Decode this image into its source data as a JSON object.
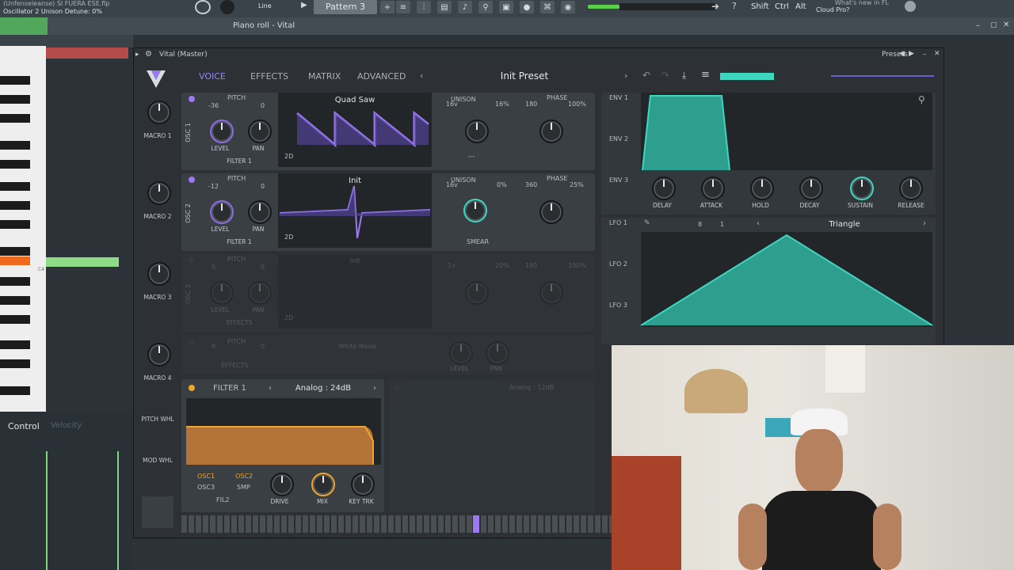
{
  "fl": {
    "title_line": "(Unfenseleanse) SI FUERA ESE.flp",
    "hint_line": "Oscillator 2 Unison Detune: 0%",
    "line_label": "Line",
    "pattern_label": "Pattern 3",
    "shift_label": "Shift",
    "ctrl_label": "Ctrl",
    "alt_label": "Alt",
    "news_label": "What's new in FL",
    "cloud_label": "Cloud Pro?",
    "piano_roll_title": "Piano roll - Vital",
    "control_label": "Control",
    "velocity_label": "Velocity",
    "note_label": "C4"
  },
  "vital": {
    "window_title": "Vital (Master)",
    "presets_label": "Presets",
    "tabs": [
      "VOICE",
      "EFFECTS",
      "MATRIX",
      "ADVANCED"
    ],
    "preset_name": "Init Preset",
    "macros": [
      "MACRO 1",
      "MACRO 2",
      "MACRO 3",
      "MACRO 4"
    ],
    "pitch_whl": "PITCH WHL",
    "mod_whl": "MOD WHL",
    "osc1": {
      "side": "OSC 1",
      "pitch_label": "PITCH",
      "pitch_val": "-36",
      "fine_val": "0",
      "level": "LEVEL",
      "pan": "PAN",
      "route": "FILTER 1",
      "wave": "Quad Saw",
      "mode": "2D",
      "unison": "UNISON",
      "voices": "16v",
      "detune": "16%",
      "phase": "PHASE",
      "phase_val": "180",
      "phase_rand": "100%",
      "blend": "---"
    },
    "osc2": {
      "side": "OSC 2",
      "pitch_label": "PITCH",
      "pitch_val": "-12",
      "fine_val": "0",
      "level": "LEVEL",
      "pan": "PAN",
      "route": "FILTER 1",
      "wave": "Init",
      "mode": "2D",
      "unison": "UNISON",
      "voices": "16v",
      "detune": "0%",
      "phase": "PHASE",
      "phase_val": "360",
      "phase_rand": "25%",
      "smear": "SMEAR"
    },
    "osc3": {
      "side": "OSC 3",
      "pitch_label": "PITCH",
      "pitch_val": "0",
      "fine_val": "0",
      "level": "LEVEL",
      "pan": "PAN",
      "route": "EFFECTS",
      "wave": "Init",
      "mode": "2D",
      "voices": "1v",
      "detune": "20%",
      "phase_val": "180",
      "phase_rand": "100%"
    },
    "smp": {
      "pitch_val": "0",
      "pitch_label": "PITCH",
      "fine_val": "0",
      "wave": "White Noise",
      "route": "EFFECTS",
      "level": "LEVEL",
      "pan": "PAN"
    },
    "filter1": {
      "title": "FILTER 1",
      "model": "Analog : 24dB",
      "sources": [
        "OSC1",
        "OSC2",
        "OSC3",
        "SMP",
        "FIL2"
      ],
      "drive": "DRIVE",
      "mix": "MIX",
      "keytrk": "KEY TRK"
    },
    "filter2": {
      "model": "Analog : 12dB"
    },
    "env": {
      "labels": [
        "ENV 1",
        "ENV 2",
        "ENV 3"
      ],
      "knobs": [
        "DELAY",
        "ATTACK",
        "HOLD",
        "DECAY",
        "SUSTAIN",
        "RELEASE"
      ]
    },
    "lfo": {
      "labels": [
        "LFO 1",
        "LFO 2",
        "LFO 3"
      ],
      "shape": "Triangle",
      "rate_num": "8",
      "rate_den": "1"
    }
  },
  "colors": {
    "accent_purple": "#9b7af0",
    "accent_teal": "#3fd6c0",
    "accent_orange": "#f0a42a"
  }
}
